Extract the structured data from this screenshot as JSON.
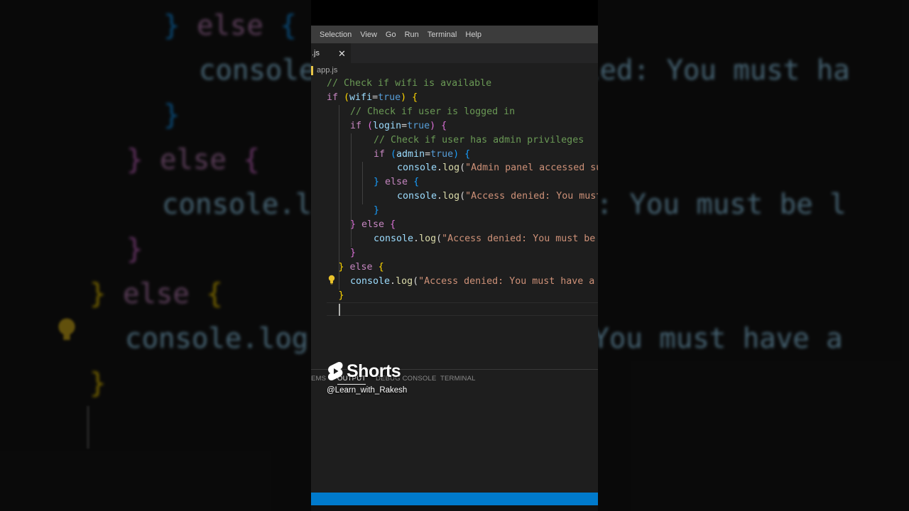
{
  "menu": [
    "Selection",
    "View",
    "Go",
    "Run",
    "Terminal",
    "Help"
  ],
  "tab": {
    "label": ".js",
    "close": "✕"
  },
  "breadcrumb": {
    "file": "app.js"
  },
  "code_lines": [
    {
      "indent": 0,
      "tokens": [
        [
          "comment",
          "// Check if wifi is available"
        ]
      ]
    },
    {
      "indent": 0,
      "tokens": [
        [
          "kw",
          "if "
        ],
        [
          "p1",
          "("
        ],
        [
          "var",
          "wifi"
        ],
        [
          "op",
          "="
        ],
        [
          "bool",
          "true"
        ],
        [
          "p1",
          ")"
        ],
        [
          "op",
          " "
        ],
        [
          "p1",
          "{"
        ]
      ]
    },
    {
      "indent": 1,
      "tokens": [
        [
          "comment",
          "// Check if user is logged in"
        ]
      ]
    },
    {
      "indent": 1,
      "tokens": [
        [
          "kw",
          "if "
        ],
        [
          "p2",
          "("
        ],
        [
          "var",
          "login"
        ],
        [
          "op",
          "="
        ],
        [
          "bool",
          "true"
        ],
        [
          "p2",
          ")"
        ],
        [
          "op",
          " "
        ],
        [
          "p2",
          "{"
        ]
      ]
    },
    {
      "indent": 2,
      "tokens": [
        [
          "comment",
          "// Check if user has admin privileges"
        ]
      ]
    },
    {
      "indent": 2,
      "tokens": [
        [
          "kw",
          "if "
        ],
        [
          "p3",
          "("
        ],
        [
          "var",
          "admin"
        ],
        [
          "op",
          "="
        ],
        [
          "bool",
          "true"
        ],
        [
          "p3",
          ")"
        ],
        [
          "op",
          " "
        ],
        [
          "p3",
          "{"
        ]
      ]
    },
    {
      "indent": 3,
      "tokens": [
        [
          "var",
          "console"
        ],
        [
          "op",
          "."
        ],
        [
          "fn",
          "log"
        ],
        [
          "op",
          "("
        ],
        [
          "str",
          "\"Admin panel accessed succe"
        ]
      ]
    },
    {
      "indent": 2,
      "tokens": [
        [
          "p3",
          "}"
        ],
        [
          "op",
          " "
        ],
        [
          "kw",
          "else"
        ],
        [
          "op",
          " "
        ],
        [
          "p3",
          "{"
        ]
      ]
    },
    {
      "indent": 3,
      "tokens": [
        [
          "var",
          "console"
        ],
        [
          "op",
          "."
        ],
        [
          "fn",
          "log"
        ],
        [
          "op",
          "("
        ],
        [
          "str",
          "\"Access denied: You must ha"
        ]
      ]
    },
    {
      "indent": 2,
      "tokens": [
        [
          "p3",
          "}"
        ]
      ]
    },
    {
      "indent": 1,
      "tokens": [
        [
          "p2",
          "}"
        ],
        [
          "op",
          " "
        ],
        [
          "kw",
          "else"
        ],
        [
          "op",
          " "
        ],
        [
          "p2",
          "{"
        ]
      ]
    },
    {
      "indent": 2,
      "tokens": [
        [
          "var",
          "console"
        ],
        [
          "op",
          "."
        ],
        [
          "fn",
          "log"
        ],
        [
          "op",
          "("
        ],
        [
          "str",
          "\"Access denied: You must be l"
        ]
      ]
    },
    {
      "indent": 1,
      "tokens": [
        [
          "p2",
          "}"
        ]
      ]
    },
    {
      "indent": 0.5,
      "tokens": [
        [
          "p1",
          "}"
        ],
        [
          "op",
          " "
        ],
        [
          "kw",
          "else"
        ],
        [
          "op",
          " "
        ],
        [
          "p1",
          "{"
        ]
      ]
    },
    {
      "indent": 1,
      "tokens": [
        [
          "var",
          "console"
        ],
        [
          "op",
          "."
        ],
        [
          "fn",
          "log"
        ],
        [
          "op",
          "("
        ],
        [
          "str",
          "\"Access denied: You must have a"
        ]
      ]
    },
    {
      "indent": 0.5,
      "tokens": [
        [
          "p1",
          "}"
        ]
      ]
    }
  ],
  "panel_tabs": [
    "EMS",
    "OUTPUT",
    "DEBUG CONSOLE",
    "TERMINAL"
  ],
  "panel_active": "OUTPUT",
  "shorts": {
    "label": "Shorts",
    "channel": "@Learn_with_Rakesh"
  },
  "background_code": [
    {
      "tokens": [
        [
          "p3",
          "} "
        ],
        [
          "kw",
          "else "
        ],
        [
          "p3",
          "{"
        ]
      ]
    },
    {
      "tokens": [
        [
          "var",
          "console.log(\"Access denied: You must ha"
        ]
      ]
    },
    {
      "tokens": [
        [
          "p3",
          "}"
        ]
      ]
    },
    {
      "tokens": [
        [
          "p2",
          "} "
        ],
        [
          "kw",
          "else "
        ],
        [
          "p2",
          "{"
        ]
      ]
    },
    {
      "tokens": [
        [
          "var",
          "console.log(\"Access denied: You must be l"
        ]
      ]
    },
    {
      "tokens": [
        [
          "p2",
          "}"
        ]
      ]
    },
    {
      "tokens": [
        [
          "p1",
          "} "
        ],
        [
          "kw",
          "else "
        ],
        [
          "p1",
          "{"
        ]
      ]
    },
    {
      "tokens": [
        [
          "var",
          "console.log(\"Access denied: You must have a"
        ]
      ]
    },
    {
      "tokens": [
        [
          "p1",
          "}"
        ]
      ]
    }
  ],
  "colors": {
    "comment": "#6a9955",
    "keyword": "#c586c0",
    "variable": "#9cdcfe",
    "boolean": "#569cd6",
    "function": "#dcdcaa",
    "string": "#ce9178",
    "statusbar": "#007acc"
  }
}
